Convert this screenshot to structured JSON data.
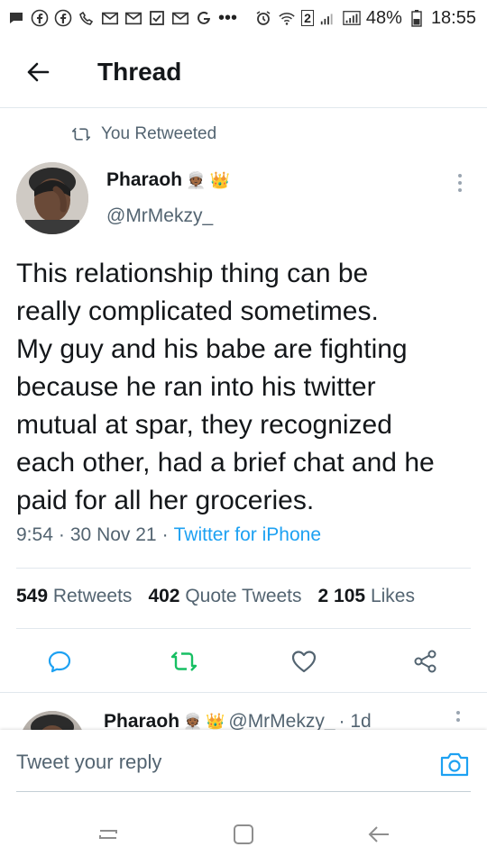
{
  "status_bar": {
    "sim_badge": "2",
    "battery": "48%",
    "time": "18:55",
    "more_dots": "•••"
  },
  "header": {
    "title": "Thread"
  },
  "tweet": {
    "retweeted_label": "You Retweeted",
    "author": {
      "name": "Pharaoh",
      "emoji_1": "👳🏾",
      "emoji_2": "👑",
      "handle": "@MrMekzy_"
    },
    "text_lines": [
      "This relationship thing can be",
      "really complicated sometimes.",
      "My guy and his babe are fighting",
      "because he ran into his twitter",
      "mutual at spar, they recognized",
      "each other, had a brief chat and he",
      "paid for all her groceries."
    ],
    "time": "9:54",
    "date": "30 Nov 21",
    "separator": "·",
    "source": "Twitter for iPhone",
    "stats": {
      "retweets_count": "549",
      "retweets_label": "Retweets",
      "quotes_count": "402",
      "quotes_label": "Quote Tweets",
      "likes_count": "2 105",
      "likes_label": "Likes"
    }
  },
  "reply_preview": {
    "name": "Pharaoh",
    "emoji_1": "👳🏾",
    "emoji_2": "👑",
    "handle": "@MrMekzy_",
    "age": "· 1d"
  },
  "composer": {
    "placeholder": "Tweet your reply"
  },
  "colors": {
    "accent": "#1da1f2",
    "retweet_active": "#17bf63",
    "text_primary": "#14171a",
    "text_secondary": "#536471",
    "divider": "#e1e8ed"
  },
  "icons": {
    "back": "arrow-left-icon",
    "retweet": "retweet-icon",
    "more": "more-vertical-icon",
    "reply": "reply-icon",
    "like": "heart-icon",
    "share": "share-icon",
    "camera": "camera-icon"
  }
}
